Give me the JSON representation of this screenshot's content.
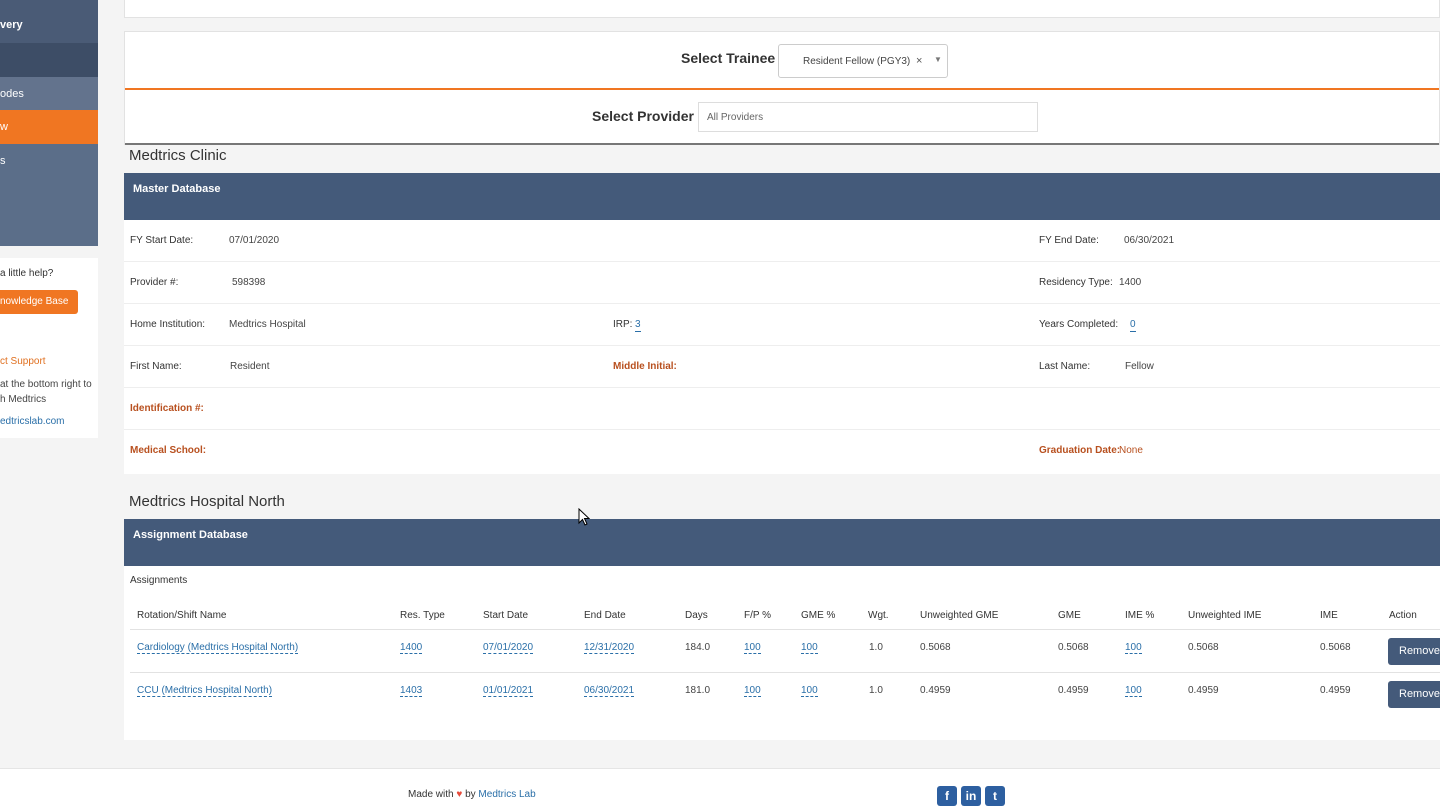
{
  "sidebar": {
    "nav": [
      {
        "label": "very"
      },
      {
        "label": ""
      },
      {
        "label": "odes"
      },
      {
        "label": "w"
      },
      {
        "label": "s"
      }
    ],
    "help": {
      "question": "a little help?",
      "kb_button": "nowledge Base",
      "contact_title": "ct Support",
      "contact_line1": "at the bottom right to",
      "contact_line2": "h Medtrics",
      "contact_email": "edtricslab.com"
    }
  },
  "selectors": {
    "trainee_label": "Select Trainee",
    "trainee_value": "Resident Fellow (PGY3)",
    "trainee_clear": "×",
    "provider_label": "Select Provider",
    "provider_placeholder": "All Providers"
  },
  "clinic": {
    "title": "Medtrics Clinic",
    "panel_title": "Master Database",
    "fy_start_label": "FY Start Date:",
    "fy_start": "07/01/2020",
    "fy_end_label": "FY End Date:",
    "fy_end": "06/30/2021",
    "provider_num_label": "Provider #:",
    "provider_num": "598398",
    "residency_type_label": "Residency Type:",
    "residency_type": "1400",
    "home_inst_label": "Home Institution:",
    "home_inst": "Medtrics Hospital",
    "irp_label": "IRP:",
    "irp": "3",
    "years_label": "Years Completed:",
    "years": "0",
    "first_name_label": "First Name:",
    "first_name": "Resident",
    "middle_label": "Middle Initial:",
    "last_name_label": "Last Name:",
    "last_name": "Fellow",
    "id_label": "Identification #:",
    "med_school_label": "Medical School:",
    "grad_label": "Graduation Date:",
    "grad": "None"
  },
  "north": {
    "title": "Medtrics Hospital North",
    "panel_title": "Assignment Database",
    "assignments_label": "Assignments",
    "headers": [
      "Rotation/Shift Name",
      "Res. Type",
      "Start Date",
      "End Date",
      "Days",
      "F/P %",
      "GME %",
      "Wgt.",
      "Unweighted GME",
      "GME",
      "IME %",
      "Unweighted IME",
      "IME",
      "Action"
    ],
    "rows": [
      {
        "name": "Cardiology (Medtrics Hospital North)",
        "res_type": "1400",
        "start": "07/01/2020",
        "end": "12/31/2020",
        "days": "184.0",
        "fp": "100",
        "gme_pct": "100",
        "wgt": "1.0",
        "unw_gme": "0.5068",
        "gme": "0.5068",
        "ime_pct": "100",
        "unw_ime": "0.5068",
        "ime": "0.5068",
        "action": "Remove"
      },
      {
        "name": "CCU (Medtrics Hospital North)",
        "res_type": "1403",
        "start": "01/01/2021",
        "end": "06/30/2021",
        "days": "181.0",
        "fp": "100",
        "gme_pct": "100",
        "wgt": "1.0",
        "unw_gme": "0.4959",
        "gme": "0.4959",
        "ime_pct": "100",
        "unw_ime": "0.4959",
        "ime": "0.4959",
        "action": "Remove"
      }
    ]
  },
  "footer": {
    "made_with": "Made with",
    "heart": "♥",
    "by": "by",
    "lab": "Medtrics Lab",
    "icons": [
      "facebook-icon",
      "linkedin-icon",
      "twitter-icon"
    ]
  },
  "colors": {
    "accent": "#f07622",
    "panel": "#445a7a",
    "link": "#2a6fa8",
    "alert": "#b8501f"
  }
}
